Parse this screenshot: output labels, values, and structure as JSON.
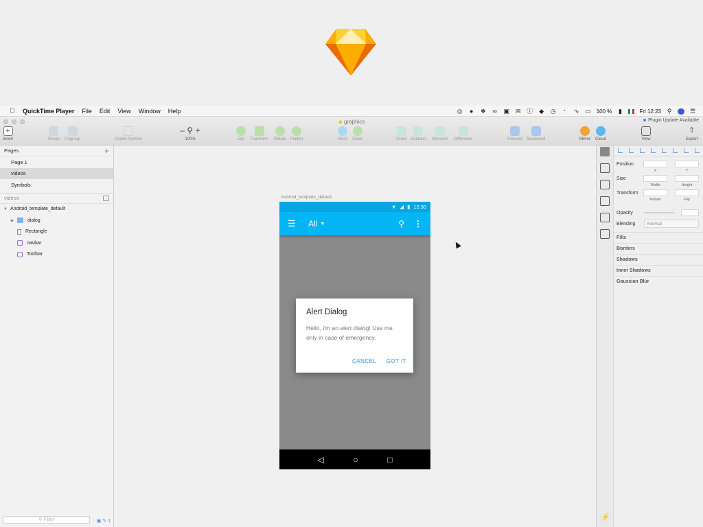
{
  "menubar": {
    "app_name": "QuickTime Player",
    "menus": [
      "File",
      "Edit",
      "View",
      "Window",
      "Help"
    ],
    "battery": "100 %",
    "clock": "Fri 12:23"
  },
  "window": {
    "title": "graphics",
    "plugin_notice": "Plugin Update Available"
  },
  "toolbar": {
    "insert": "Insert",
    "group": "Group",
    "ungroup": "Ungroup",
    "create_symbol": "Create Symbol",
    "zoom": "100%",
    "edit": "Edit",
    "transform": "Transform",
    "rotate": "Rotate",
    "flatten": "Flatten",
    "mask": "Mask",
    "scale": "Scale",
    "union": "Union",
    "subtract": "Subtract",
    "intersect": "Intersect",
    "difference": "Difference",
    "forward": "Forward",
    "backward": "Backward",
    "mirror": "Mirror",
    "cloud": "Cloud",
    "view": "View",
    "export": "Export"
  },
  "sidebar": {
    "pages_label": "Pages",
    "pages": [
      {
        "label": "Page 1"
      },
      {
        "label": "videos",
        "selected": true
      },
      {
        "label": "Symbols"
      }
    ],
    "section_label": "videos",
    "artboard": "Android_template_default",
    "layers": [
      {
        "label": "dialog",
        "icon": "folder-icon"
      },
      {
        "label": "Rectangle",
        "icon": "rectangle-icon"
      },
      {
        "label": "navbar",
        "icon": "symbol-icon"
      },
      {
        "label": "Toolbar",
        "icon": "symbol-icon"
      }
    ],
    "filter_placeholder": "Filter",
    "count": "1"
  },
  "canvas": {
    "artboard_label": "Android_template_default",
    "phone": {
      "status_time": "12:30",
      "appbar_title": "All",
      "dialog": {
        "title": "Alert Dialog",
        "body": "Hello, i'm an alert dialog! Use me only in case of emergency.",
        "cancel": "CANCEL",
        "confirm": "GOT IT"
      }
    }
  },
  "inspector": {
    "position": "Position",
    "x": "X",
    "y": "Y",
    "size": "Size",
    "width": "Width",
    "height": "Height",
    "transform": "Transform",
    "rotate": "Rotate",
    "flip": "Flip",
    "opacity": "Opacity",
    "blending": "Blending",
    "blending_value": "Normal",
    "sections": [
      "Fills",
      "Borders",
      "Shadows",
      "Inner Shadows",
      "Gaussian Blur"
    ]
  },
  "colors": {
    "appbar": "#04b5f6",
    "statusbar": "#06a7e1",
    "accent": "#2196f3"
  }
}
